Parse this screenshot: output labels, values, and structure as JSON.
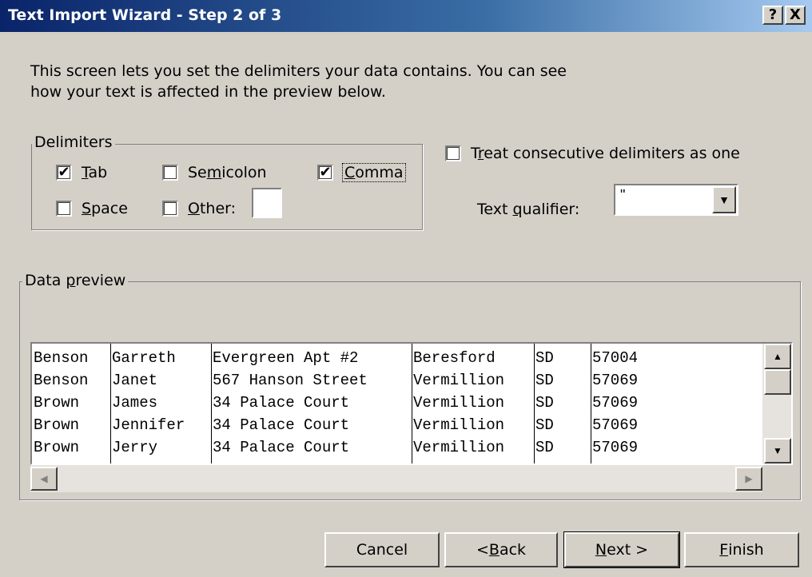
{
  "window": {
    "title": "Text Import Wizard - Step 2 of 3",
    "help_button": "?",
    "close_button": "X"
  },
  "intro": {
    "line1": "This screen lets you set the delimiters your data contains.  You can see",
    "line2": "how your text is affected in the preview below."
  },
  "delimiters": {
    "group_label": "Delimiters",
    "options": [
      {
        "label_pre": "",
        "label_key": "T",
        "label_post": "ab",
        "checked": true
      },
      {
        "label_pre": "Se",
        "label_key": "m",
        "label_post": "icolon",
        "checked": false
      },
      {
        "label_pre": "",
        "label_key": "C",
        "label_post": "omma",
        "checked": true
      },
      {
        "label_pre": "",
        "label_key": "S",
        "label_post": "pace",
        "checked": false
      },
      {
        "label_pre": "",
        "label_key": "O",
        "label_post": "ther:",
        "checked": false
      }
    ],
    "other_value": ""
  },
  "treat_consecutive": {
    "label_pre": "T",
    "label_key": "r",
    "label_post": "eat consecutive delimiters as one",
    "checked": false
  },
  "text_qualifier": {
    "label_pre": "Text ",
    "label_key": "q",
    "label_post": "ualifier:",
    "value": "\""
  },
  "preview": {
    "group_label_pre": "Data ",
    "group_label_key": "p",
    "group_label_post": "review",
    "rows": [
      [
        "Benson",
        "Garreth",
        "Evergreen Apt #2",
        "Beresford",
        "SD",
        "57004"
      ],
      [
        "Benson",
        "Janet",
        "567 Hanson Street",
        "Vermillion",
        "SD",
        "57069"
      ],
      [
        "Brown",
        "James",
        "34 Palace Court",
        "Vermillion",
        "SD",
        "57069"
      ],
      [
        "Brown",
        "Jennifer",
        "34 Palace Court",
        "Vermillion",
        "SD",
        "57069"
      ],
      [
        "Brown",
        "Jerry",
        "34 Palace Court",
        "Vermillion",
        "SD",
        "57069"
      ]
    ]
  },
  "buttons": {
    "cancel": "Cancel",
    "back_pre": "< ",
    "back_key": "B",
    "back_post": "ack",
    "next_key": "N",
    "next_post": "ext >",
    "finish_key": "F",
    "finish_post": "inish"
  },
  "icons": {
    "checkmark": "✔",
    "dropdown": "▼",
    "scroll_up": "▲",
    "scroll_down": "▼",
    "scroll_left": "◀",
    "scroll_right": "▶"
  }
}
